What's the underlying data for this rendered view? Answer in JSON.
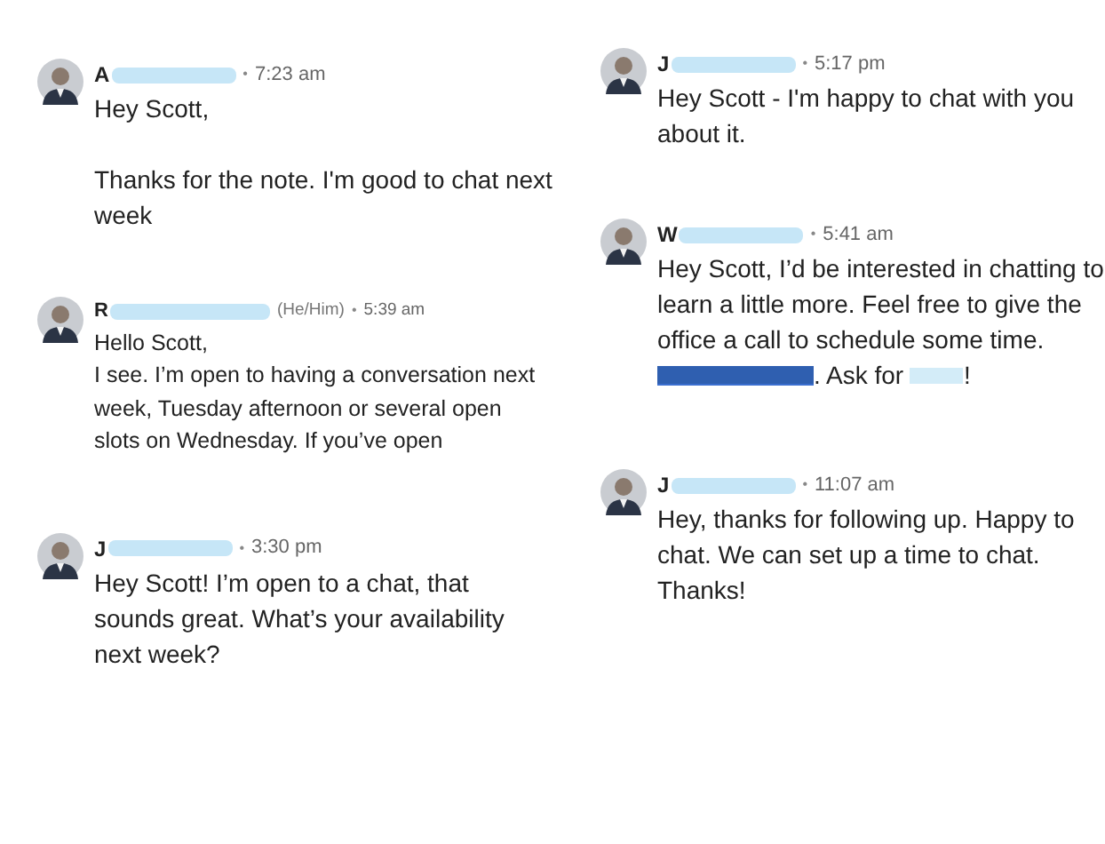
{
  "columns": [
    {
      "messages": [
        {
          "kind": "standard",
          "name": "A",
          "time": "7:23 am",
          "dot": "•",
          "body": [
            {
              "kind": "text",
              "text": "Hey Scott,"
            },
            {
              "kind": "spacer"
            },
            {
              "kind": "text",
              "text": "Thanks for the note. I'm good to chat next week"
            }
          ]
        },
        {
          "kind": "compact",
          "name": "R",
          "pronouns": "(He/Him)",
          "time": "5:39 am",
          "dot": "•",
          "body": [
            {
              "kind": "text",
              "text": "Hello Scott,"
            },
            {
              "kind": "text",
              "text": "I see. I’m open to having a conversation next week, Tuesday afternoon or several open slots on Wednesday. If you’ve open"
            }
          ]
        },
        {
          "kind": "standard",
          "name": "J",
          "time": "3:30 pm",
          "dot": "•",
          "body": [
            {
              "kind": "text",
              "text": "Hey Scott! I’m open to a chat, that sounds great. What’s your availability next week?"
            }
          ]
        }
      ]
    },
    {
      "messages": [
        {
          "kind": "standard",
          "name": "J",
          "time": "5:17 pm",
          "dot": "•",
          "body": [
            {
              "kind": "text",
              "text": "Hey Scott - I'm happy to chat with you about it."
            }
          ]
        },
        {
          "kind": "standard",
          "name": "W",
          "time": "5:41 am",
          "dot": "•",
          "body": [
            {
              "kind": "text",
              "text": "Hey Scott, I’d be interested in chatting to learn a little more. Feel free to give the office a call to schedule some time."
            },
            {
              "kind": "mixed",
              "parts": [
                {
                  "kind": "redacted_link"
                },
                {
                  "kind": "text",
                  "text": ". Ask for "
                },
                {
                  "kind": "redacted"
                },
                {
                  "kind": "text",
                  "text": "!"
                }
              ]
            }
          ]
        },
        {
          "kind": "standard",
          "name": "J",
          "time": "11:07 am",
          "dot": "•",
          "body": [
            {
              "kind": "text",
              "text": "Hey, thanks for following up. Happy to chat. We can set up a time to chat. Thanks!"
            }
          ]
        }
      ]
    }
  ]
}
